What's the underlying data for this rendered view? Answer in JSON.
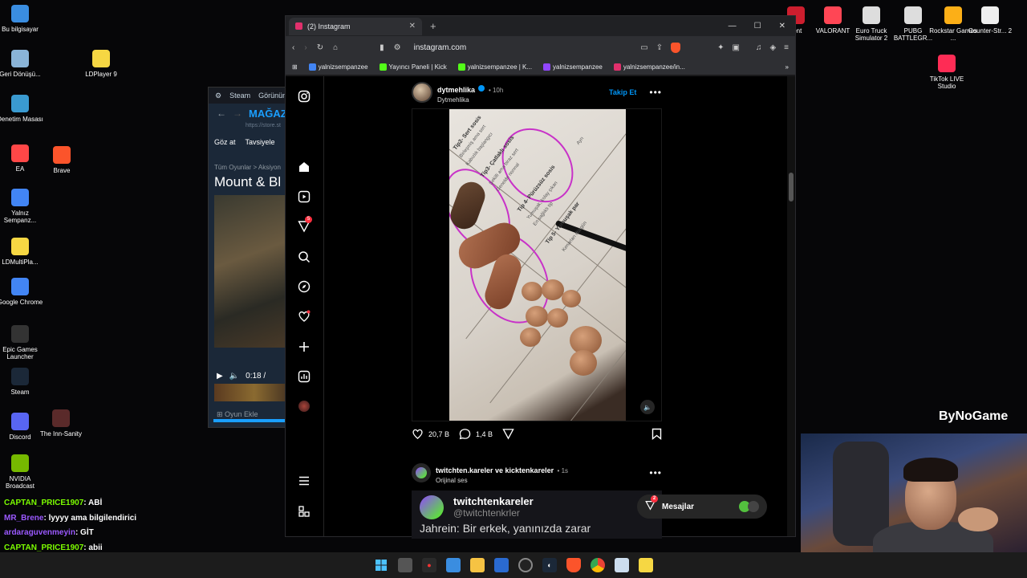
{
  "desktop": {
    "left_icons": [
      {
        "label": "Bu bilgisayar",
        "color": "#3a8de0"
      },
      {
        "label": "Geri Dönüşü...",
        "color": "#8ab4d8"
      },
      {
        "label": "Denetim Masası",
        "color": "#3a9ad0"
      },
      {
        "label": "EA",
        "color": "#ff4747"
      },
      {
        "label": "Yalnız Sempanz...",
        "color": "#4285f4"
      },
      {
        "label": "LDMultiPla...",
        "color": "#f6d743"
      },
      {
        "label": "Google Chrome",
        "color": "#4285f4"
      },
      {
        "label": "Epic Games Launcher",
        "color": "#333333"
      },
      {
        "label": "Steam",
        "color": "#1b2838"
      },
      {
        "label": "Discord",
        "color": "#5865f2"
      },
      {
        "label": "NVIDIA Broadcast",
        "color": "#76b900"
      }
    ],
    "mid_icons": [
      {
        "label": "LDPlayer 9",
        "color": "#f6d743"
      },
      {
        "label": "Brave",
        "color": "#fb542b"
      },
      {
        "label": "The Inn-Sanity",
        "color": "#5a2a2a"
      }
    ],
    "right_icons": [
      {
        "label": "lient",
        "color": "#cc1e2e"
      },
      {
        "label": "VALORANT",
        "color": "#ff4655"
      },
      {
        "label": "Euro Truck Simulator 2",
        "color": "#dddddd"
      },
      {
        "label": "PUBG BATTLEGR...",
        "color": "#dddddd"
      },
      {
        "label": "Rockstar Games ...",
        "color": "#fcaf17"
      },
      {
        "label": "Counter-Str... 2",
        "color": "#eeeeee"
      },
      {
        "label": "TikTok LIVE Studio",
        "color": "#fe2c55"
      }
    ],
    "bynogame": "ByNoGame"
  },
  "steam": {
    "title": "Steam",
    "menu": "Görünüm",
    "store": "MAĞAZ",
    "url": "https://store.st",
    "nav1": "Göz at",
    "nav2": "Tavsiyele",
    "crumb": "Tüm Oyunlar > Aksiyon",
    "game_title": "Mount & Bl",
    "time": "0:18 /",
    "add_game": "Oyun Ekle"
  },
  "browser": {
    "tab_title": "(2) Instagram",
    "url": "instagram.com",
    "bookmarks": [
      {
        "label": "yalnizsempanzee",
        "color": "#4285f4"
      },
      {
        "label": "Yayıncı Paneli | Kick",
        "color": "#53fc18"
      },
      {
        "label": "yalnizsempanzee | K...",
        "color": "#53fc18"
      },
      {
        "label": "yalnizsempanzee",
        "color": "#9146ff"
      },
      {
        "label": "yalnizsempanzee/in...",
        "color": "#e1306c"
      }
    ]
  },
  "instagram": {
    "sidebar_badge": "5",
    "post": {
      "username": "dytmehlika",
      "time": "10h",
      "subtitle": "Dytmehlika",
      "follow": "Takip Et",
      "likes": "20,7 B",
      "comments": "1,4 B",
      "handwriting": [
        "Tip2- Sert sosis",
        "Tip3- Çatlaklı sosis",
        "Tip 4- Pürüzsüz sosis",
        "Tip 5- Yumuşak par"
      ],
      "notes": [
        "Birleşmiş ama sert",
        "Kabızlık başlangıcı",
        "Şekilli ama biraz sert",
        "Genelde normal",
        "Yumuşak, kolay çıkan",
        "En sağlıklı tip",
        "Kenarları düzgün",
        "Ayrı"
      ]
    },
    "post2": {
      "users": "twitchten.kareler ve kicktenkareler",
      "time": "1s",
      "audio": "Orijinal ses",
      "tweet_name": "twitchtenkareler",
      "tweet_handle": "@twitchtenkrler",
      "tweet_text": "Jahrein: Bir erkek, yanınızda zarar"
    },
    "messages": {
      "label": "Mesajlar",
      "badge": "2"
    }
  },
  "chat": [
    {
      "user": "CAPTAN_PRICE1907",
      "text": ": ABİ",
      "color": "#7cfc00"
    },
    {
      "user": "MR_Brene",
      "text": ": lyyyy ama bilgilendirici",
      "color": "#9b59ff"
    },
    {
      "user": "ardaraguvenmeyin",
      "text": ": GİT",
      "color": "#9b59ff"
    },
    {
      "user": "CAPTAN_PRICE1907",
      "text": ": abii",
      "color": "#7cfc00"
    }
  ]
}
